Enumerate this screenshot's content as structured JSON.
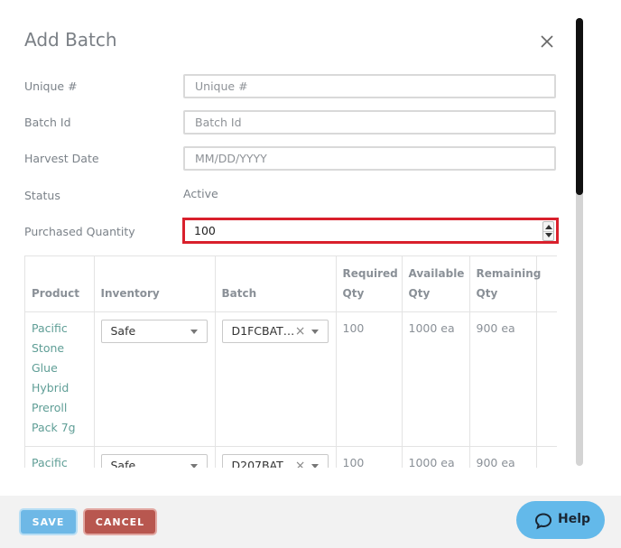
{
  "modal": {
    "title": "Add Batch",
    "close_icon": "close-icon"
  },
  "form": {
    "unique": {
      "label": "Unique #",
      "placeholder": "Unique #",
      "value": ""
    },
    "batch_id": {
      "label": "Batch Id",
      "placeholder": "Batch Id",
      "value": ""
    },
    "harvest_date": {
      "label": "Harvest Date",
      "placeholder": "MM/DD/YYYY",
      "value": ""
    },
    "status": {
      "label": "Status",
      "value": "Active"
    },
    "purchased_quantity": {
      "label": "Purchased Quantity",
      "value": "100",
      "highlight_color": "#d9202c"
    }
  },
  "table": {
    "headers": {
      "product": "Product",
      "inventory": "Inventory",
      "batch": "Batch",
      "required_qty": "Required Qty",
      "available_qty": "Available Qty",
      "remaining_qty": "Remaining Qty"
    },
    "rows": [
      {
        "product": "Pacific Stone Glue Hybrid Preroll Pack 7g",
        "inventory": "Safe",
        "batch": "D1FCBAT…",
        "required_qty": "100",
        "available_qty": "1000 ea",
        "remaining_qty": "900 ea"
      },
      {
        "product": "Pacific",
        "inventory": "Safe",
        "batch": "D207BAT…",
        "required_qty": "100",
        "available_qty": "1000 ea",
        "remaining_qty": "900 ea"
      }
    ]
  },
  "footer": {
    "save_label": "SAVE",
    "cancel_label": "CANCEL"
  },
  "help": {
    "label": "Help",
    "icon": "chat-bubble-icon"
  },
  "colors": {
    "accent_link": "#5f9e96",
    "save": "#6eb8e6",
    "cancel": "#b8574f",
    "help": "#63b9ea"
  }
}
